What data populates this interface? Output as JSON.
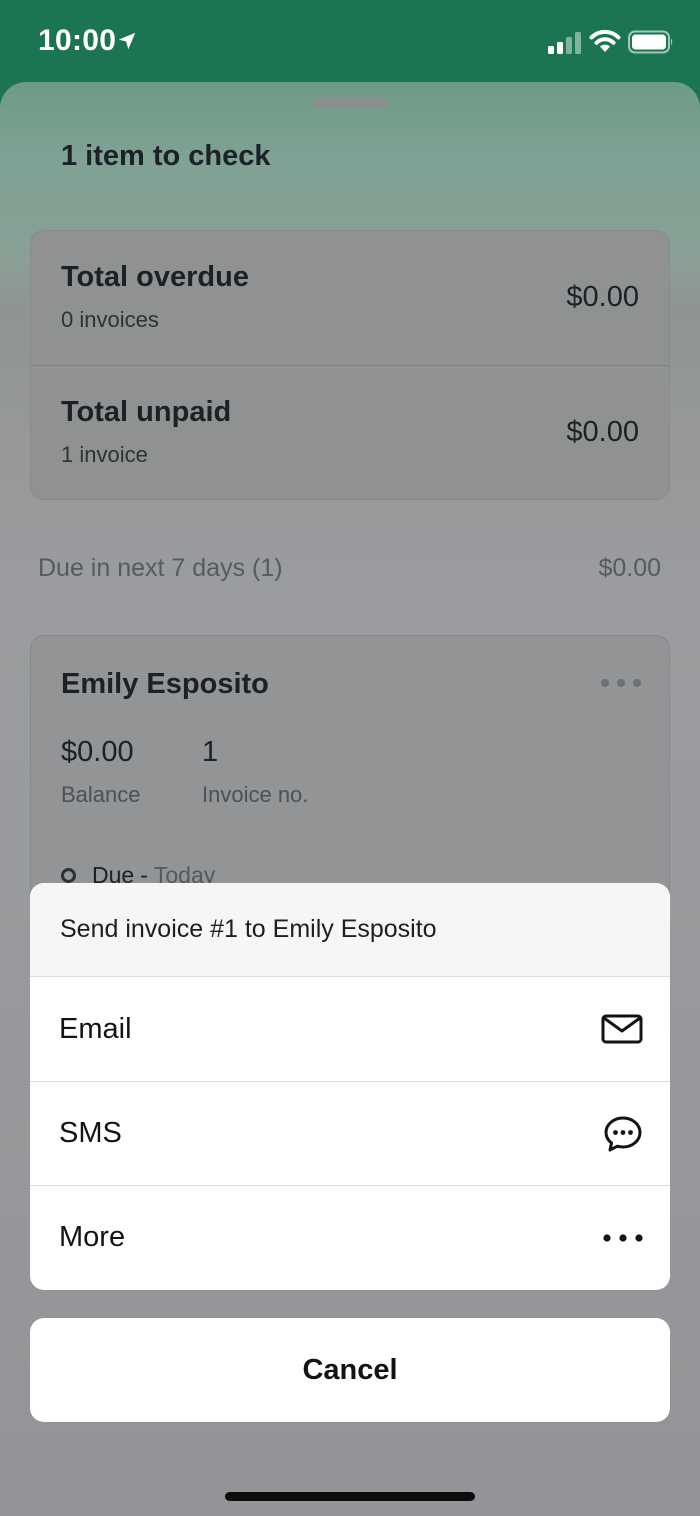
{
  "status_bar": {
    "time": "10:00",
    "location_icon": "location-arrow-icon",
    "signal_icon": "cellular-signal-icon",
    "wifi_icon": "wifi-icon",
    "battery_icon": "battery-icon"
  },
  "sheet": {
    "title": "1 item to check",
    "summary": [
      {
        "title": "Total overdue",
        "subtitle": "0 invoices",
        "amount": "$0.00"
      },
      {
        "title": "Total unpaid",
        "subtitle": "1 invoice",
        "amount": "$0.00"
      }
    ],
    "due_section": {
      "label": "Due in next 7 days (1)",
      "amount": "$0.00"
    },
    "invoice_card": {
      "customer": "Emily Esposito",
      "balance_value": "$0.00",
      "balance_label": "Balance",
      "invoice_value": "1",
      "invoice_label": "Invoice no.",
      "status_word": "Due",
      "status_dash": "-",
      "status_date": "Today"
    }
  },
  "action_sheet": {
    "title": "Send invoice #1 to Emily Esposito",
    "items": [
      {
        "label": "Email",
        "icon": "envelope-icon"
      },
      {
        "label": "SMS",
        "icon": "chat-bubble-icon"
      },
      {
        "label": "More",
        "icon": "more-dots-icon"
      }
    ],
    "cancel": "Cancel"
  },
  "colors": {
    "status_bar": "#1b7550",
    "scrim": "#959798",
    "sheet_surface": "#ffffff",
    "text_primary": "#111417"
  }
}
